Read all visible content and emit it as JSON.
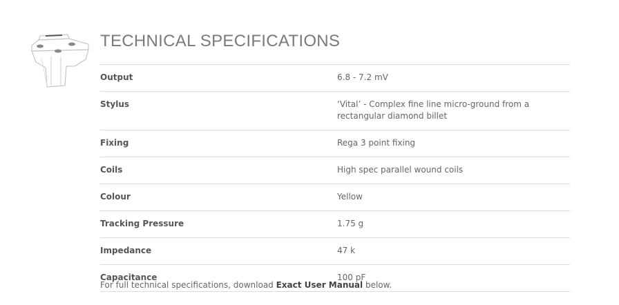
{
  "section": {
    "title": "TECHNICAL SPECIFICATIONS",
    "icon": "cartridge-icon"
  },
  "specs": [
    {
      "label": "Output",
      "value": "6.8 - 7.2 mV"
    },
    {
      "label": "Stylus",
      "value": "‘Vital’ - Complex fine line micro-ground from a rectangular diamond billet"
    },
    {
      "label": "Fixing",
      "value": "Rega 3 point fixing"
    },
    {
      "label": "Coils",
      "value": "High spec parallel wound coils"
    },
    {
      "label": "Colour",
      "value": "Yellow"
    },
    {
      "label": "Tracking Pressure",
      "value": "1.75 g"
    },
    {
      "label": "Impedance",
      "value": "47 k"
    },
    {
      "label": "Capacitance",
      "value": "100 pF"
    }
  ],
  "footer": {
    "prefix": "For full technical specifications, download ",
    "link": "Exact User Manual",
    "suffix": " below."
  }
}
